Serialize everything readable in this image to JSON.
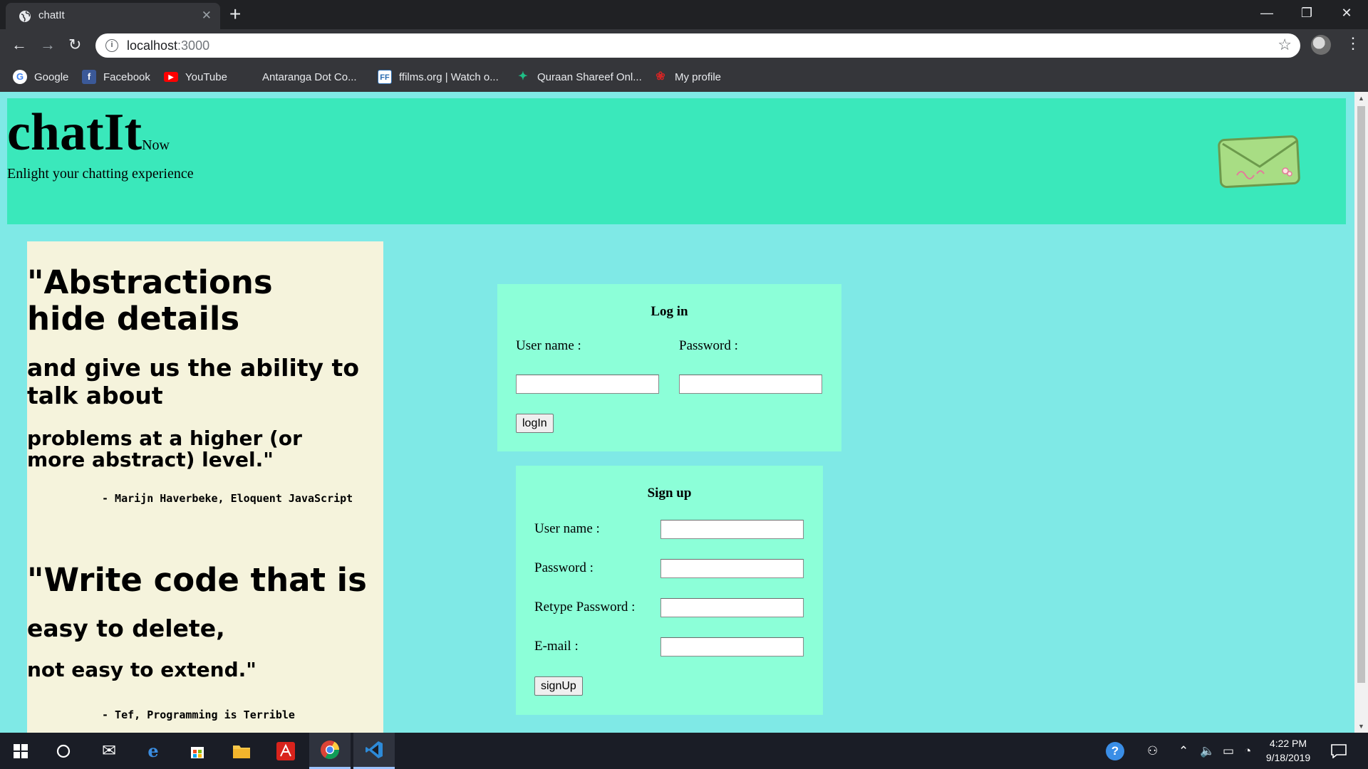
{
  "browser": {
    "tab_title": "chatIt",
    "url_host": "localhost",
    "url_port": ":3000",
    "bookmarks": [
      {
        "label": "Google",
        "icon": "google-icon",
        "color": "#4285f4"
      },
      {
        "label": "Facebook",
        "icon": "facebook-icon",
        "color": "#3b5998"
      },
      {
        "label": "YouTube",
        "icon": "youtube-icon",
        "color": "#ff0000"
      },
      {
        "label": "Antaranga Dot Co...",
        "icon": "blank-page-icon",
        "color": "#35363a"
      },
      {
        "label": "ffilms.org | Watch o...",
        "icon": "ffilms-icon",
        "color": "#2b6cb0"
      },
      {
        "label": "Quraan Shareef Onl...",
        "icon": "quran-icon",
        "color": "#1a9c6a"
      },
      {
        "label": "My profile",
        "icon": "profile-icon",
        "color": "#b11c1c"
      }
    ]
  },
  "header": {
    "brand": "chatIt",
    "brand_suffix": "Now",
    "tagline": "Enlight your chatting experience"
  },
  "quotes": [
    {
      "line1": "\"Abstractions hide details",
      "line2": "and give us the ability to talk about",
      "line3": "problems at a higher (or more abstract) level.\"",
      "cite": "- Marijn Haverbeke, Eloquent JavaScript"
    },
    {
      "line1": "\"Write code that is",
      "line2": "easy to delete,",
      "line3": "not easy to extend.\"",
      "cite": "- Tef, Programming is Terrible"
    }
  ],
  "login": {
    "title": "Log in",
    "username_label": "User name :",
    "password_label": "Password :",
    "username_value": "",
    "password_value": "",
    "button": "logIn"
  },
  "signup": {
    "title": "Sign up",
    "username_label": "User name :",
    "password_label": "Password :",
    "retype_label": "Retype Password :",
    "email_label": "E-mail :",
    "username_value": "",
    "password_value": "",
    "retype_value": "",
    "email_value": "",
    "button": "signUp"
  },
  "taskbar": {
    "time": "4:22 PM",
    "date": "9/18/2019"
  },
  "colors": {
    "header_bg": "#3ae8bb",
    "page_bg": "#7fe9e6",
    "panel_bg": "#8cffd8",
    "quote_bg": "#f5f3dc"
  }
}
